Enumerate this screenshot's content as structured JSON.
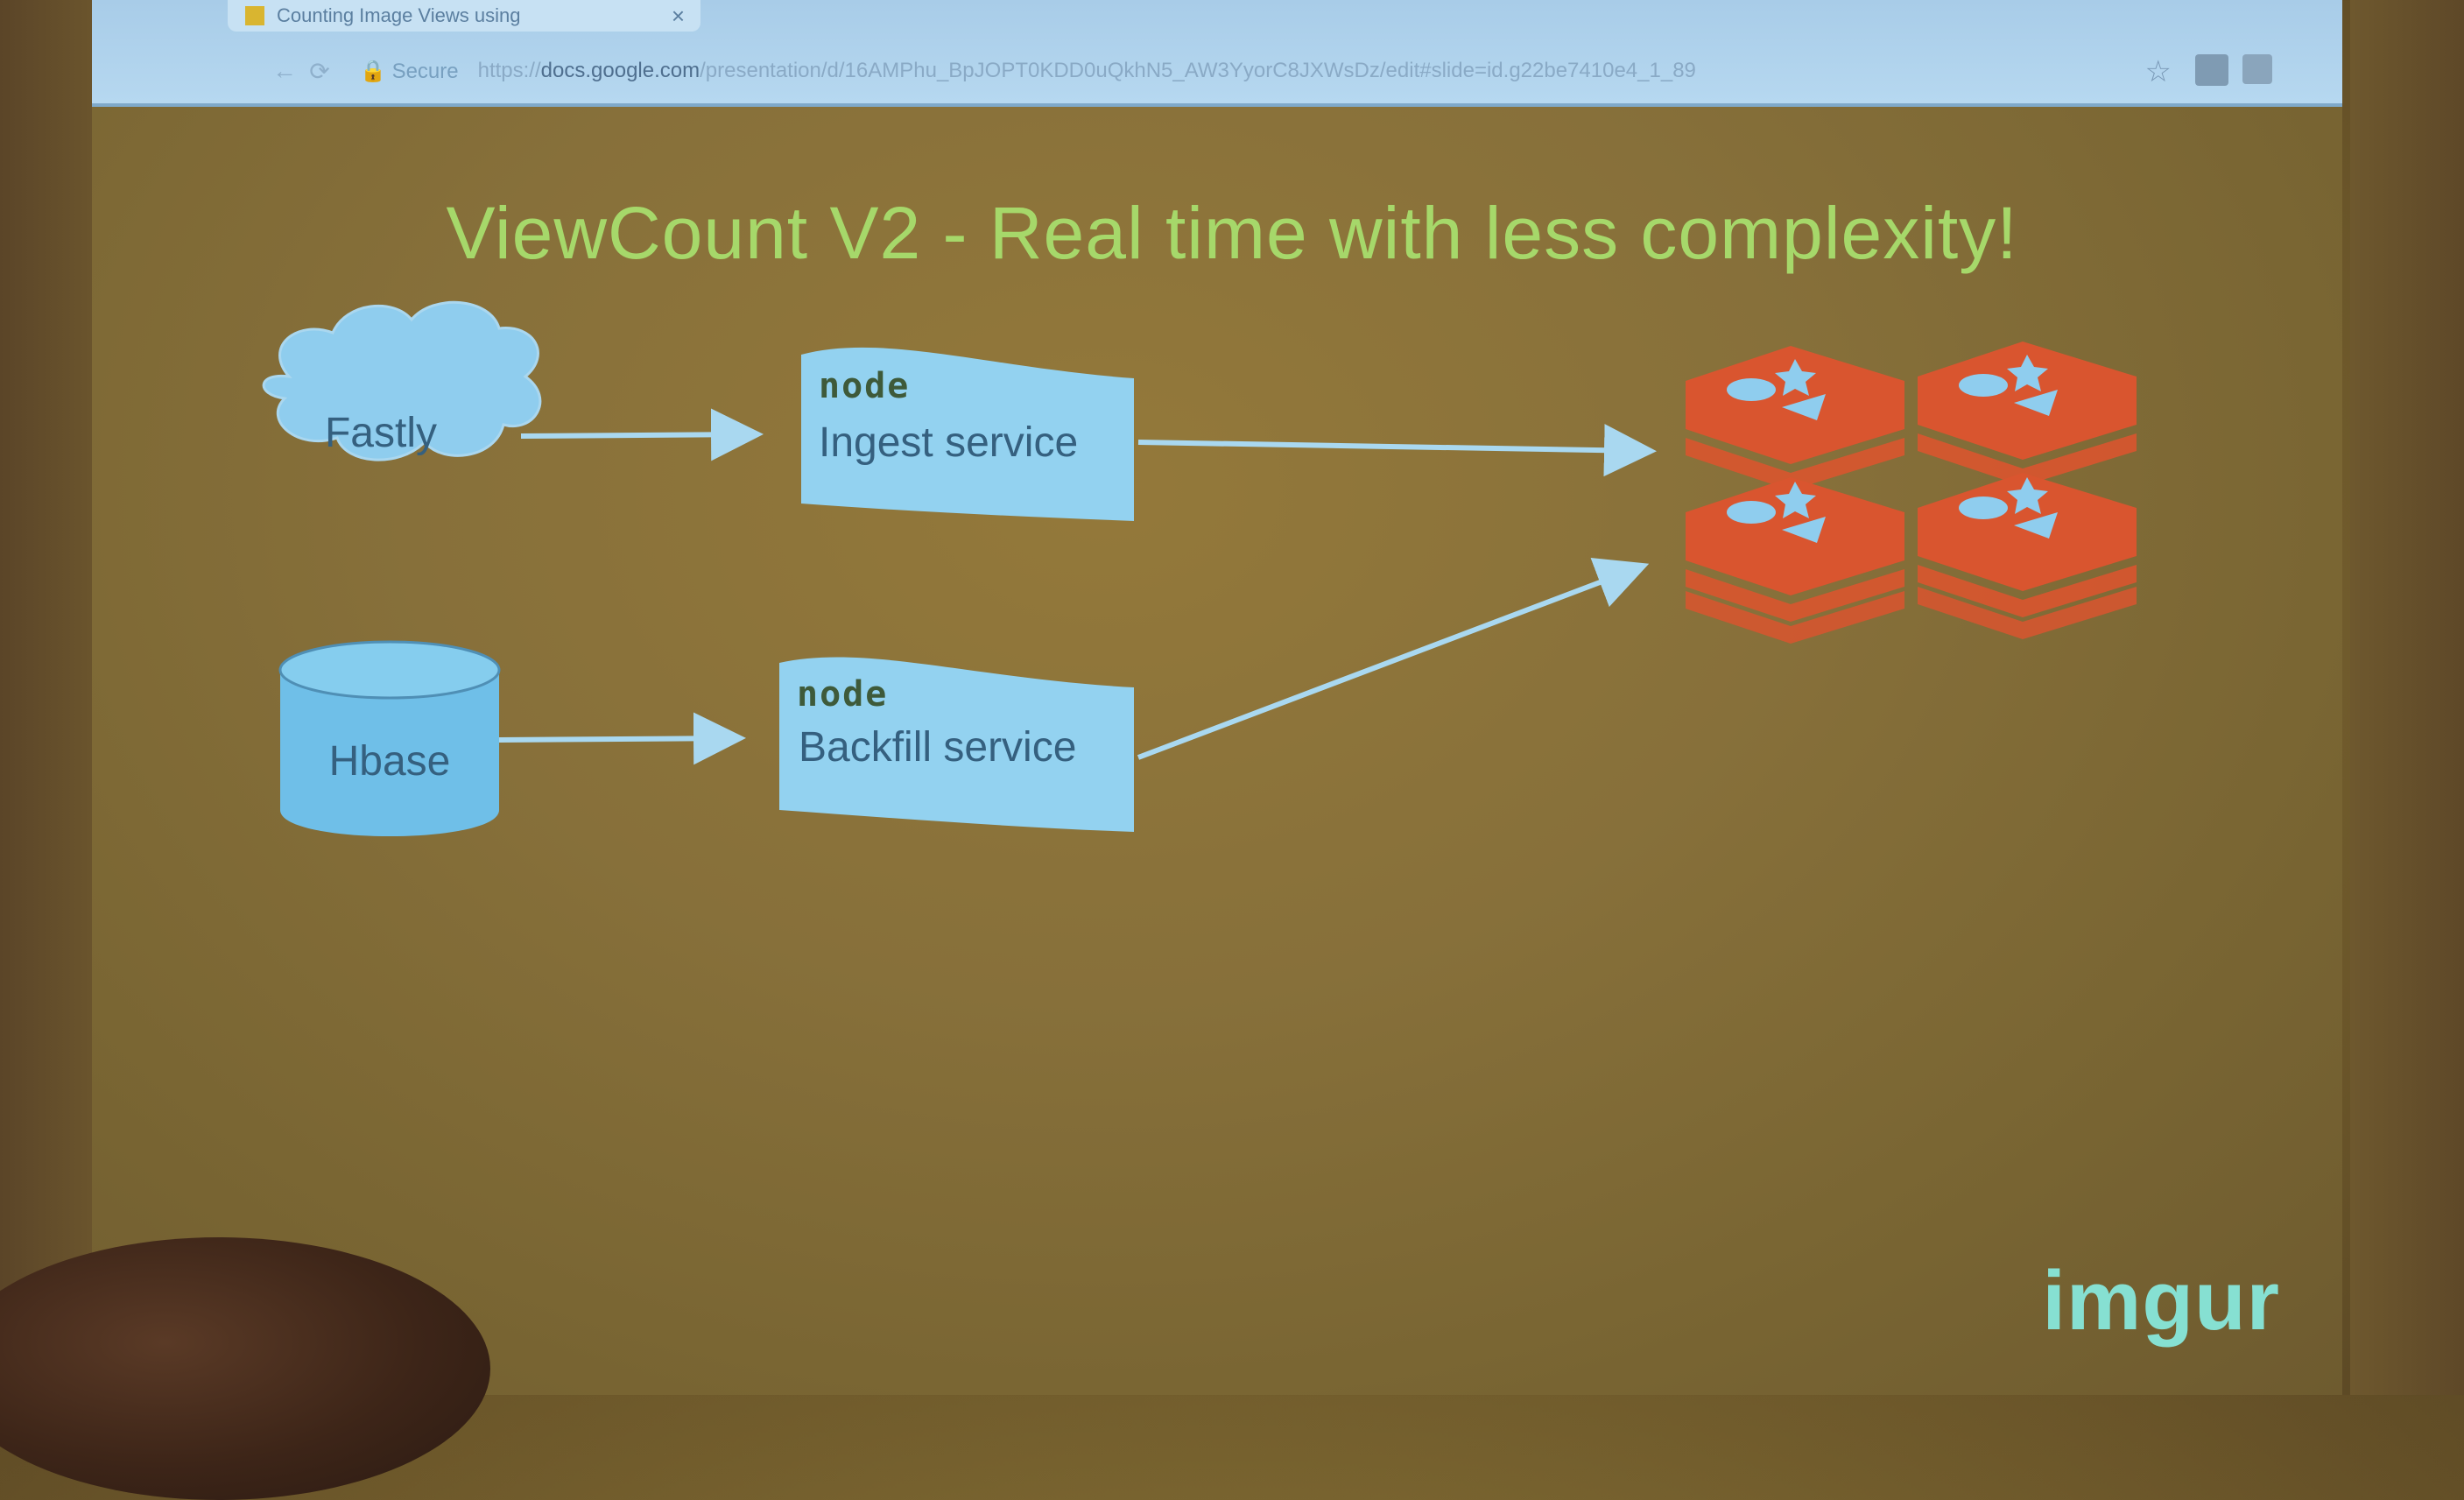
{
  "browser": {
    "tab_title": "Counting Image Views using",
    "tab_close": "×",
    "secure_label": "Secure",
    "url_scheme": "https://",
    "url_host": "docs.google.com",
    "url_rest": "/presentation/d/16AMPhu_BpJOPT0KDD0uQkhN5_AW3YyorC8JXWsDz/edit#slide=id.g22be7410e4_1_89"
  },
  "slide": {
    "title": "ViewCount V2 - Real time with less complexity!",
    "nodes": {
      "fastly": "Fastly",
      "hbase": "Hbase",
      "ingest_logo": "node",
      "ingest_label": "Ingest service",
      "backfill_logo": "node",
      "backfill_label": "Backfill service"
    },
    "logo": "imgur"
  },
  "colors": {
    "title": "#a6d86a",
    "node_fill": "#7cc8ec",
    "arrow": "#a9d8f0",
    "redis": "#d9552f",
    "imgur": "#86e0d2"
  },
  "icons": {
    "redis": "redis-logo-icon"
  }
}
